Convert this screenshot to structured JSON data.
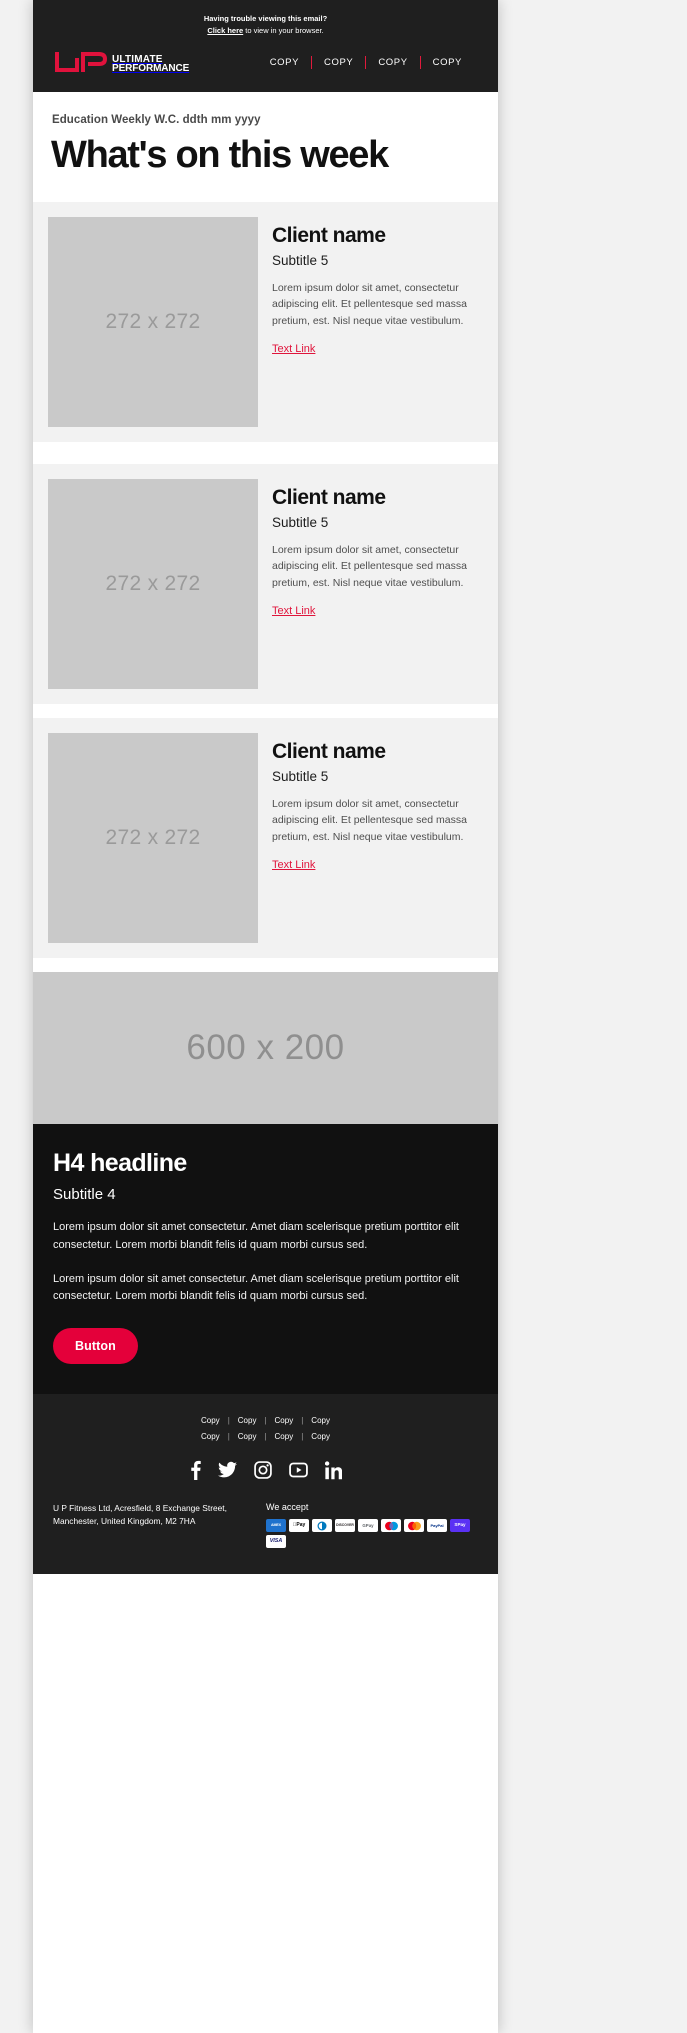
{
  "header": {
    "preheader_line1": "Having trouble viewing this email?",
    "preheader_link": "Click here",
    "preheader_rest": " to view in your browser.",
    "logo_line1": "ULTIMATE",
    "logo_line2": "PERFORMANCE",
    "logo_alt": "up-logo",
    "nav": [
      {
        "label": "COPY"
      },
      {
        "label": "COPY"
      },
      {
        "label": "COPY"
      },
      {
        "label": "COPY"
      }
    ],
    "background_color": "#1f1f1f",
    "accent_color": "#e01a3c"
  },
  "hero": {
    "eyebrow": "Education Weekly W.C. ddth mm yyyy",
    "title": "What's on this week"
  },
  "cards": [
    {
      "image_label": "272 x 272",
      "title": "Client name",
      "subtitle": "Subtitle 5",
      "body": "Lorem ipsum dolor sit amet, consectetur adipiscing elit. Et pellentesque sed massa pretium, est. Nisl neque vitae vestibulum.",
      "link": "Text Link"
    },
    {
      "image_label": "272 x 272",
      "title": "Client name",
      "subtitle": "Subtitle 5",
      "body": "Lorem ipsum dolor sit amet, consectetur adipiscing elit. Et pellentesque sed massa pretium, est. Nisl neque vitae vestibulum.",
      "link": "Text Link"
    },
    {
      "image_label": "272 x 272",
      "title": "Client name",
      "subtitle": "Subtitle 5",
      "body": "Lorem ipsum dolor sit amet, consectetur adipiscing elit. Et pellentesque sed massa pretium, est. Nisl neque vitae vestibulum.",
      "link": "Text Link"
    }
  ],
  "banner": {
    "image_label": "600 x 200"
  },
  "cta": {
    "headline": "H4 headline",
    "subtitle": "Subtitle 4",
    "paragraph1": "Lorem ipsum dolor sit amet consectetur. Amet diam scelerisque pretium porttitor elit consectetur. Lorem morbi blandit felis id quam morbi cursus sed.",
    "paragraph2": "Lorem ipsum dolor sit amet consectetur. Amet diam scelerisque pretium porttitor elit consectetur. Lorem morbi blandit felis id quam morbi cursus sed.",
    "button_label": "Button",
    "button_color": "#e4003a",
    "background_color": "#111111"
  },
  "footer": {
    "links_row1": [
      {
        "label": "Copy"
      },
      {
        "label": "Copy"
      },
      {
        "label": "Copy"
      },
      {
        "label": "Copy"
      }
    ],
    "links_row2": [
      {
        "label": "Copy"
      },
      {
        "label": "Copy"
      },
      {
        "label": "Copy"
      },
      {
        "label": "Copy"
      }
    ],
    "separator": "|",
    "socials": [
      {
        "name": "facebook-icon"
      },
      {
        "name": "twitter-icon"
      },
      {
        "name": "instagram-icon"
      },
      {
        "name": "youtube-icon"
      },
      {
        "name": "linkedin-icon"
      }
    ],
    "address": "U P Fitness Ltd, Acresfield, 8 Exchange Street, Manchester, United Kingdom, M2 7HA",
    "accept_title": "We accept",
    "payments": [
      {
        "label": "AMEX",
        "key": "amex"
      },
      {
        "label": "Pay",
        "key": "apple"
      },
      {
        "label": "",
        "key": "diners"
      },
      {
        "label": "DISCOVER",
        "key": "discover"
      },
      {
        "label": "Pay",
        "key": "gpay"
      },
      {
        "label": "",
        "key": "maestro"
      },
      {
        "label": "",
        "key": "mc"
      },
      {
        "label": "PayPal",
        "key": "paypal"
      },
      {
        "label": "Pay",
        "key": "shop"
      },
      {
        "label": "VISA",
        "key": "visa"
      }
    ]
  }
}
